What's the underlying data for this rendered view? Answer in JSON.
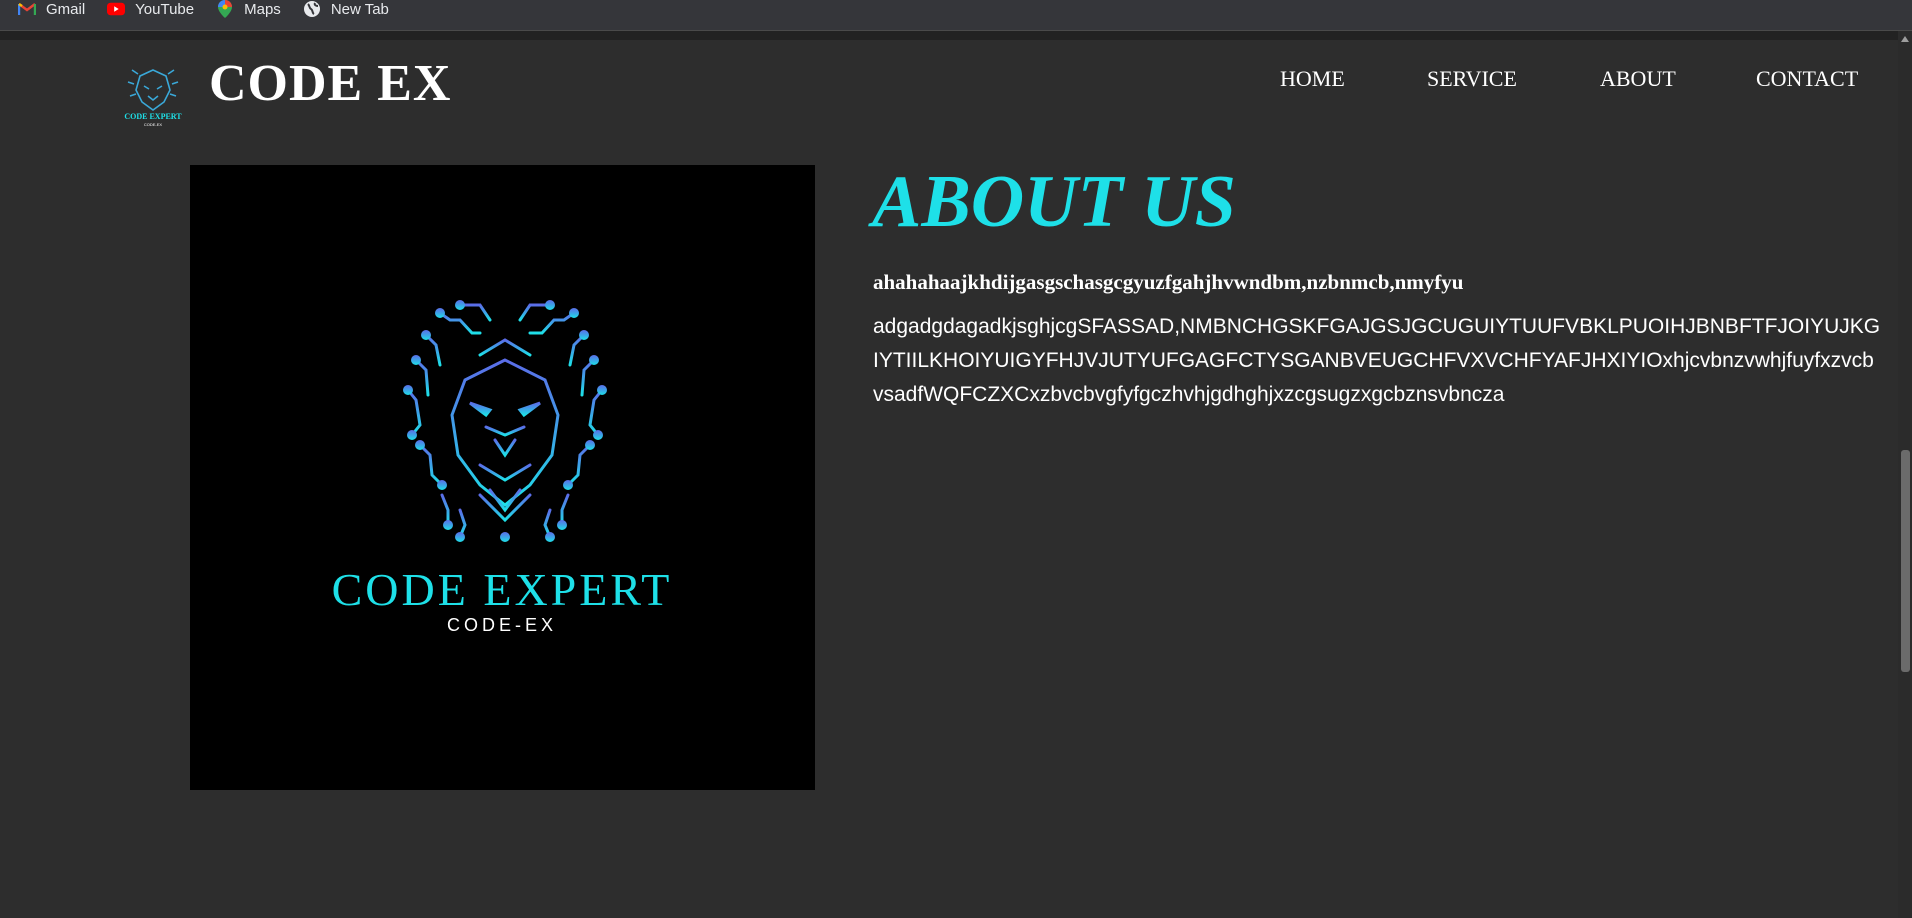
{
  "bookmarks": [
    {
      "label": "Gmail",
      "icon": "gmail-icon"
    },
    {
      "label": "YouTube",
      "icon": "youtube-icon"
    },
    {
      "label": "Maps",
      "icon": "maps-icon"
    },
    {
      "label": "New Tab",
      "icon": "globe-icon"
    }
  ],
  "navbar": {
    "brand": "CODE EX",
    "logo_text": "CODE EXPERT",
    "logo_subtext": "CODE-EX",
    "links": [
      "HOME",
      "SERVICE",
      "ABOUT",
      "CONTACT"
    ]
  },
  "hero_image": {
    "title": "CODE EXPERT",
    "subtitle": "CODE-EX"
  },
  "about": {
    "title": "ABOUT US",
    "subtitle": "ahahahaajkhdijgasgschasgcgyuzfgahjhvwndbm,nzbnmcb,nmyfyu",
    "body": "adgadgdagadkjsghjcgSFASSAD,NMBNCHGSKFGAJGSJGCUGUIYTUUFVBKLPUOIHJBNBFTFJOIYUJKGIYTIILKHOIYUIGYFHJVJUTYUFGAGFCTYSGANBVEUGCHFVXVCHFYAFJHXIYIOxhjcvbnzvwhjfuyfxzvcbvsadfWQFCZXCxzbvcbvgfyfgczhvhjgdhghjxzcgsugzxgcbznsvbncza"
  },
  "colors": {
    "accent": "#1ee0e8",
    "background": "#2d2d2d",
    "text": "#ffffff",
    "image_bg": "#000000"
  }
}
